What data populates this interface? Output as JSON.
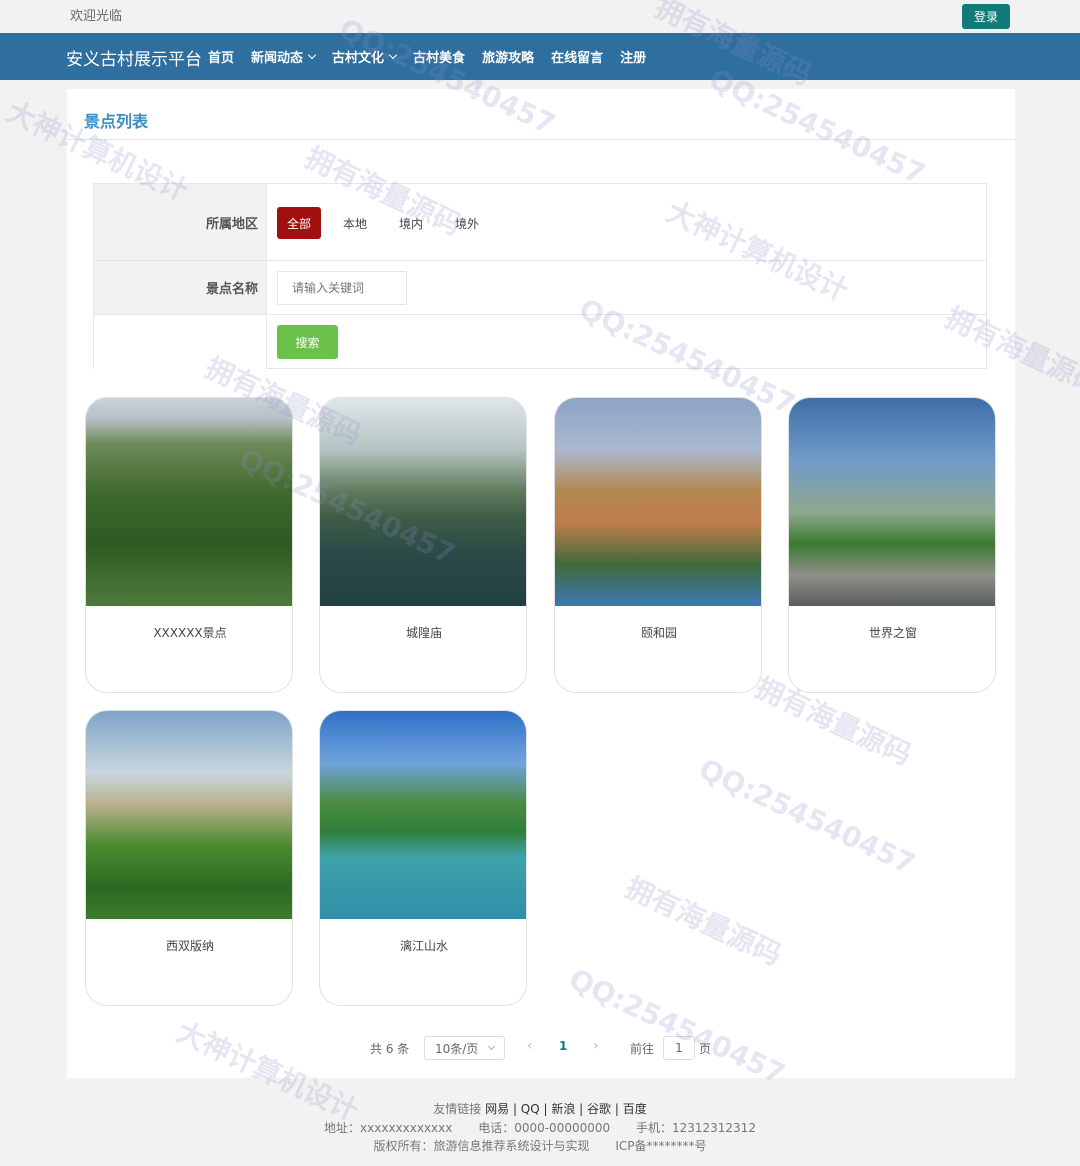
{
  "top": {
    "welcome": "欢迎光临",
    "login": "登录"
  },
  "nav": {
    "brand": "安义古村展示平台",
    "items": [
      {
        "label": "首页",
        "dropdown": false
      },
      {
        "label": "新闻动态",
        "dropdown": true
      },
      {
        "label": "古村文化",
        "dropdown": true
      },
      {
        "label": "古村美食",
        "dropdown": false
      },
      {
        "label": "旅游攻略",
        "dropdown": false
      },
      {
        "label": "在线留言",
        "dropdown": false
      },
      {
        "label": "注册",
        "dropdown": false
      }
    ]
  },
  "panel": {
    "title": "景点列表"
  },
  "filter": {
    "region_label": "所属地区",
    "regions": [
      "全部",
      "本地",
      "境内",
      "境外"
    ],
    "active_region": "全部",
    "name_label": "景点名称",
    "name_placeholder": "请输入关键词",
    "search": "搜索"
  },
  "spots": [
    {
      "name": "XXXXXX景点"
    },
    {
      "name": "城隍庙"
    },
    {
      "name": "颐和园"
    },
    {
      "name": "世界之窗"
    },
    {
      "name": "西双版纳"
    },
    {
      "name": "漓江山水"
    }
  ],
  "pager": {
    "total": "共 6 条",
    "page_size": "10条/页",
    "current": "1",
    "goto_label": "前往",
    "goto_value": "1",
    "goto_unit": "页"
  },
  "footer": {
    "links_label": "友情链接",
    "links": "网易 | QQ | 新浪 | 谷歌 | 百度",
    "address": "地址：xxxxxxxxxxxxx",
    "phone": "电话：0000-00000000",
    "mobile": "手机：12312312312",
    "copyright": "版权所有：旅游信息推荐系统设计与实现",
    "icp": "ICP备********号"
  },
  "watermarks": [
    "大神计算机设计",
    "QQ:254540457",
    "拥有海量源码"
  ],
  "colors": {
    "nav": "#2e6f9f",
    "login": "#127a78",
    "active": "#a01010",
    "search": "#6bc149",
    "title": "#3a8fc1"
  }
}
